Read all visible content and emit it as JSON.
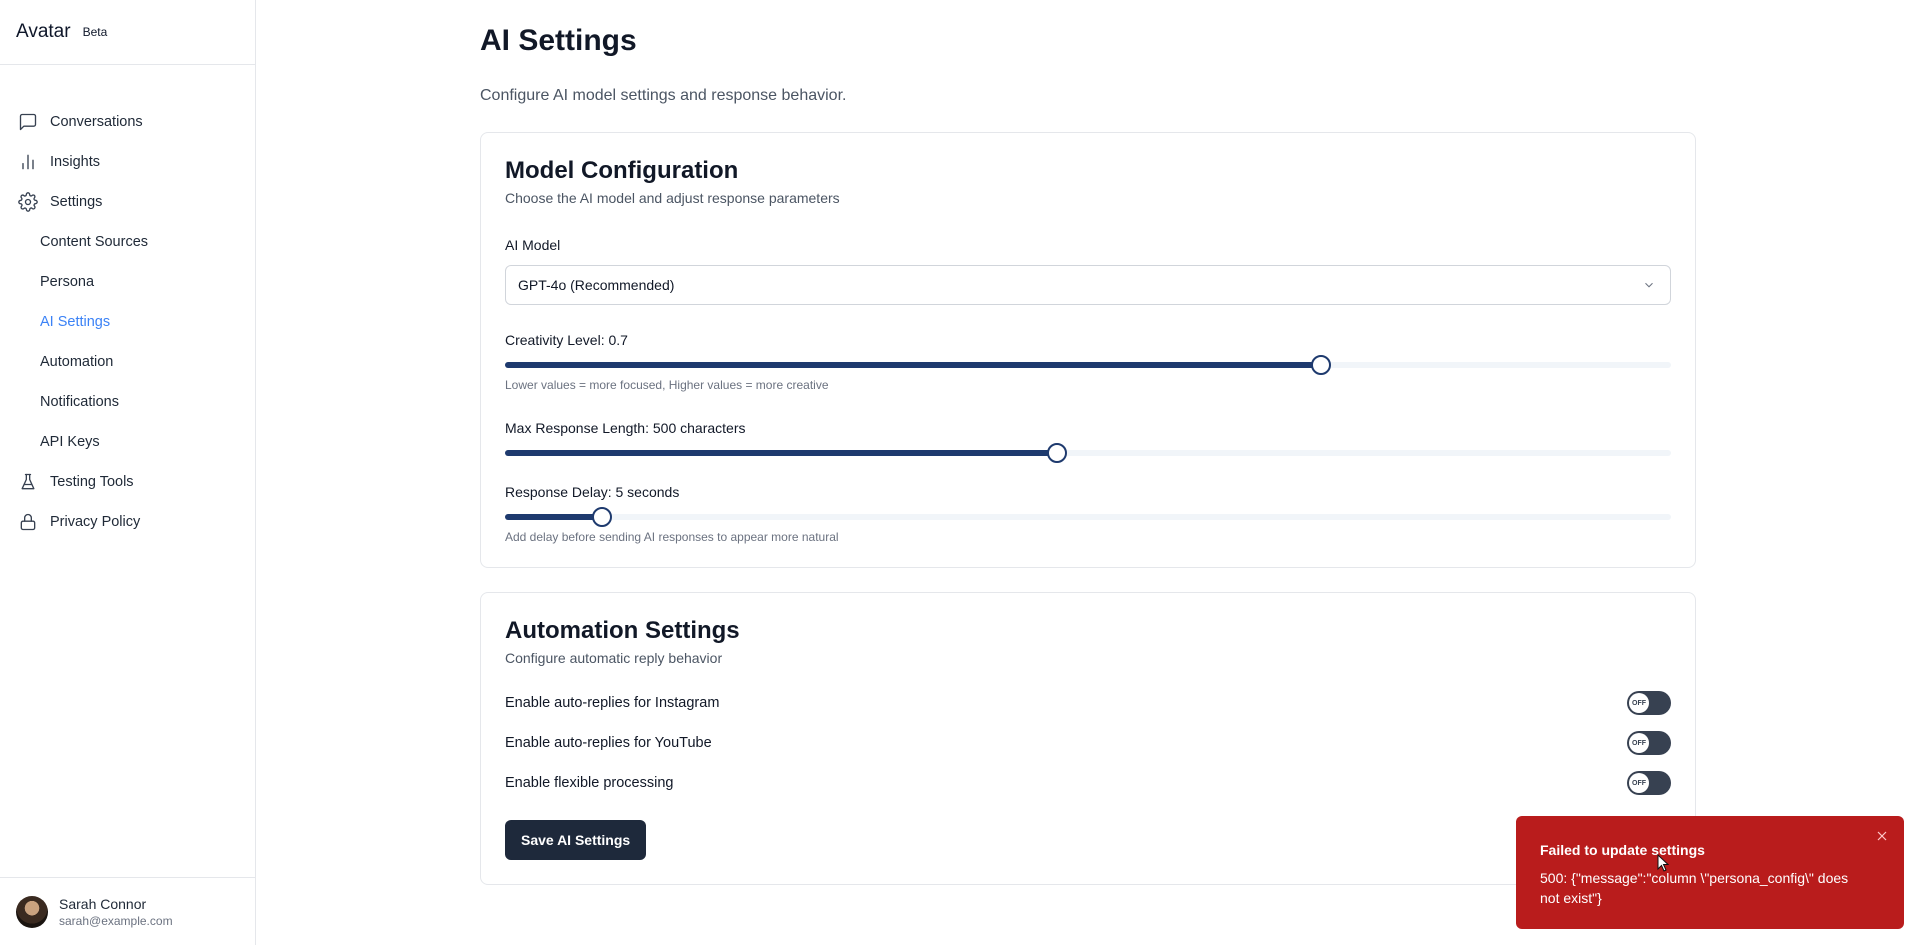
{
  "brand": {
    "name": "Avatar",
    "badge": "Beta"
  },
  "nav": {
    "conversations": "Conversations",
    "insights": "Insights",
    "settings": "Settings",
    "sub": [
      "Content Sources",
      "Persona",
      "AI Settings",
      "Automation",
      "Notifications",
      "API Keys"
    ],
    "active_sub": "AI Settings",
    "testing_tools": "Testing Tools",
    "privacy_policy": "Privacy Policy"
  },
  "user": {
    "name": "Sarah Connor",
    "email": "sarah@example.com"
  },
  "page": {
    "title": "AI Settings",
    "subtitle": "Configure AI model settings and response behavior."
  },
  "model_config": {
    "title": "Model Configuration",
    "description": "Choose the AI model and adjust response parameters",
    "model_label": "AI Model",
    "model_value": "GPT-4o (Recommended)",
    "creativity": {
      "label": "Creativity Level: 0.7",
      "value": 0.7,
      "min": 0,
      "max": 1,
      "hint": "Lower values = more focused, Higher values = more creative"
    },
    "max_length": {
      "label": "Max Response Length: 500 characters",
      "value": 500,
      "min": 50,
      "max": 1000
    },
    "delay": {
      "label": "Response Delay: 5 seconds",
      "value": 5,
      "min": 0,
      "max": 60,
      "hint": "Add delay before sending AI responses to appear more natural"
    }
  },
  "automation": {
    "title": "Automation Settings",
    "description": "Configure automatic reply behavior",
    "toggles": [
      {
        "label": "Enable auto-replies for Instagram",
        "state": "OFF"
      },
      {
        "label": "Enable auto-replies for YouTube",
        "state": "OFF"
      },
      {
        "label": "Enable flexible processing",
        "state": "OFF"
      }
    ],
    "save_label": "Save AI Settings"
  },
  "toast": {
    "title": "Failed to update settings",
    "message": "500: {\"message\":\"column \\\"persona_config\\\" does not exist\"}"
  },
  "colors": {
    "accent": "#3b82f6",
    "primary": "#1e3a6e",
    "button": "#1e293b",
    "error": "#b91c1c"
  }
}
